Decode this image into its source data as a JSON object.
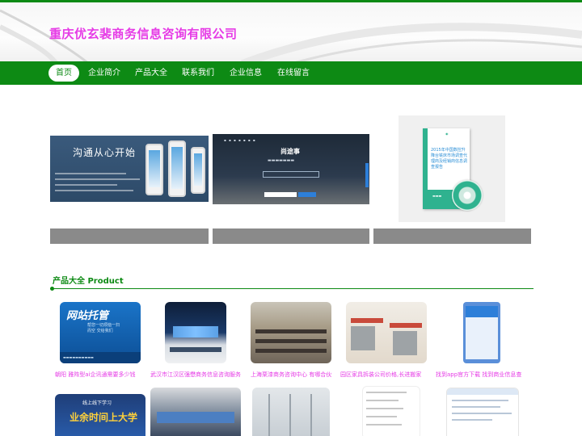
{
  "header": {
    "title": "重庆优玄裴商务信息咨询有限公司"
  },
  "nav": {
    "items": [
      {
        "label": "首页",
        "active": true
      },
      {
        "label": "企业简介"
      },
      {
        "label": "产品大全"
      },
      {
        "label": "联系我们"
      },
      {
        "label": "企业信息"
      },
      {
        "label": "在线留言"
      }
    ]
  },
  "banners": [
    {
      "headline": "沟通从心开始"
    },
    {
      "logo": "尚途事"
    },
    {
      "title": "2015年中国数控升降台铣床市场调查代理商及经销商信息调查报告"
    }
  ],
  "products_section": {
    "title": "产品大全 Product"
  },
  "products": [
    {
      "caption": "朝阳 雅阵型ai企讯通需要多少钱",
      "image_text": "网站托管",
      "image_subtext": "帮您一切烦恼一扫而空 交给我们"
    },
    {
      "caption": "武汉市江汉区强懋商务信息咨询服务"
    },
    {
      "caption": "上海栗漆商务咨询中心 有哪合伙"
    },
    {
      "caption": "园区家具拆装公司价格,长进搬家"
    },
    {
      "caption": "找到app官方下载 找到商业信息查"
    }
  ],
  "products_row2": [
    {
      "image_text": "业余时间上大学",
      "image_subtext": "线上线下学习"
    }
  ],
  "colors": {
    "brand_green": "#0d8a14",
    "title_magenta": "#e63be6",
    "caption_gray": "#8a8a8a"
  }
}
